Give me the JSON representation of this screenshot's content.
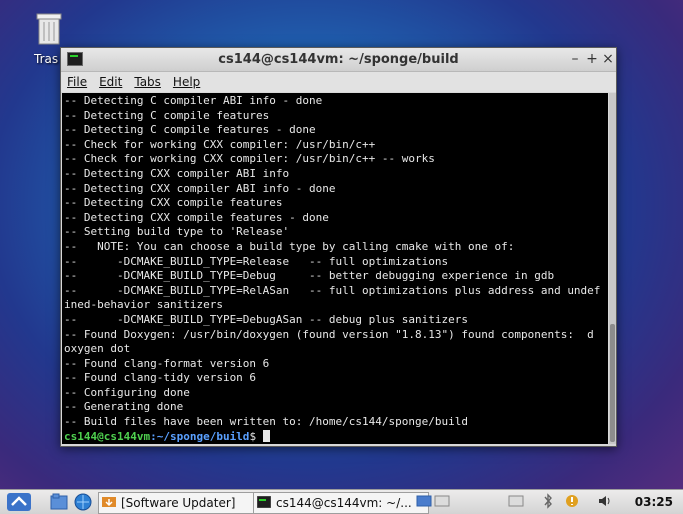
{
  "desktop": {
    "trash_label": "Tras"
  },
  "window": {
    "title": "cs144@cs144vm: ~/sponge/build",
    "controls": {
      "minimize": "–",
      "maximize": "+",
      "close": "×"
    }
  },
  "menu": {
    "file": "File",
    "edit": "Edit",
    "tabs": "Tabs",
    "help": "Help"
  },
  "terminal": {
    "lines": [
      "-- Detecting C compiler ABI info - done",
      "-- Detecting C compile features",
      "-- Detecting C compile features - done",
      "-- Check for working CXX compiler: /usr/bin/c++",
      "-- Check for working CXX compiler: /usr/bin/c++ -- works",
      "-- Detecting CXX compiler ABI info",
      "-- Detecting CXX compiler ABI info - done",
      "-- Detecting CXX compile features",
      "-- Detecting CXX compile features - done",
      "-- Setting build type to 'Release'",
      "--   NOTE: You can choose a build type by calling cmake with one of:",
      "--      -DCMAKE_BUILD_TYPE=Release   -- full optimizations",
      "--      -DCMAKE_BUILD_TYPE=Debug     -- better debugging experience in gdb",
      "--      -DCMAKE_BUILD_TYPE=RelASan   -- full optimizations plus address and undef",
      "ined-behavior sanitizers",
      "--      -DCMAKE_BUILD_TYPE=DebugASan -- debug plus sanitizers",
      "-- Found Doxygen: /usr/bin/doxygen (found version \"1.8.13\") found components:  d",
      "oxygen dot",
      "-- Found clang-format version 6",
      "-- Found clang-tidy version 6",
      "-- Configuring done",
      "-- Generating done",
      "-- Build files have been written to: /home/cs144/sponge/build"
    ],
    "prompt_user": "cs144@cs144vm",
    "prompt_path": ":~/sponge/build",
    "prompt_symbol": "$ "
  },
  "taskbar": {
    "tasks": [
      {
        "label": "[Software Updater]"
      },
      {
        "label": "cs144@cs144vm: ~/..."
      }
    ],
    "clock": "03:25"
  }
}
